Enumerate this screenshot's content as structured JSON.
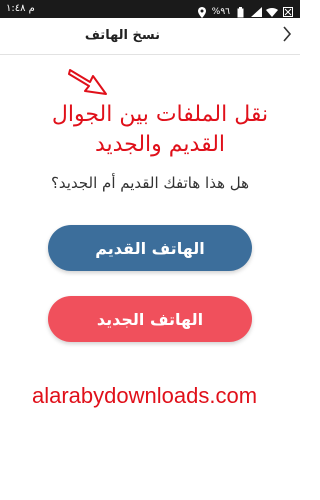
{
  "status_bar": {
    "time": "م ١:٤٨",
    "battery": "%٩٦",
    "icons": [
      "location-icon",
      "wifi-icon",
      "signal-icon",
      "battery-icon",
      "notification-icon"
    ]
  },
  "header": {
    "title": "نسخ الهاتف",
    "back_icon": "chevron-right-icon"
  },
  "annotation": {
    "line1": "نقل الملفات بين الجوال",
    "line2": "القديم والجديد",
    "color": "#e0101a"
  },
  "question": "هل هذا هاتفك القديم أم الجديد؟",
  "buttons": {
    "old_phone": "الهاتف القديم",
    "new_phone": "الهاتف الجديد"
  },
  "colors": {
    "old_button": "#3c6e9b",
    "new_button": "#f0505c"
  },
  "watermark": "alarabydownloads.com"
}
